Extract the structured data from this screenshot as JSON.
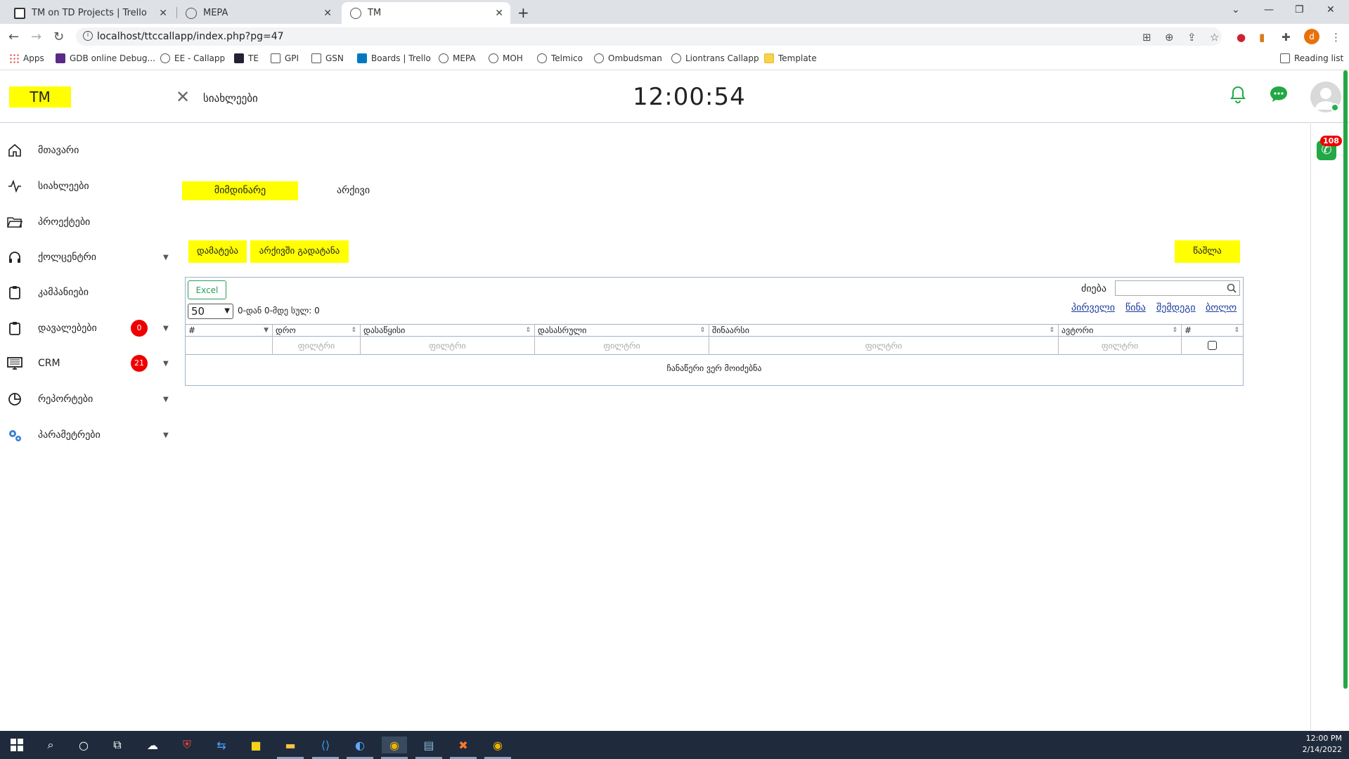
{
  "browser": {
    "tabs": [
      {
        "title": "TM on TD Projects | Trello"
      },
      {
        "title": "MEPA"
      },
      {
        "title": "TM"
      }
    ],
    "url": "localhost/ttccallapp/index.php?pg=47",
    "profile_initial": "d",
    "bookmarks": [
      "Apps",
      "GDB online Debug...",
      "EE - Callapp",
      "TE",
      "GPI",
      "GSN",
      "Boards | Trello",
      "MEPA",
      "MOH",
      "Telmico",
      "Ombudsman",
      "Liontrans Callapp",
      "Template"
    ],
    "reading_list": "Reading list"
  },
  "header": {
    "logo": "TM",
    "page_title": "სიახლეები",
    "clock": "12:00:54",
    "phone_badge": "108"
  },
  "sidebar": {
    "items": [
      {
        "label": "მთავარი"
      },
      {
        "label": "სიახლეები"
      },
      {
        "label": "პროექტები"
      },
      {
        "label": "ქოლცენტრი"
      },
      {
        "label": "კამპანიები"
      },
      {
        "label": "დავალებები",
        "badge": "0"
      },
      {
        "label": "CRM",
        "badge": "21"
      },
      {
        "label": "რეპორტები"
      },
      {
        "label": "პარამეტრები"
      }
    ]
  },
  "tabs": {
    "current": "მიმდინარე",
    "archive": "არქივი"
  },
  "toolbar": {
    "add": "დამატება",
    "to_archive": "არქივში გადატანა",
    "delete": "წაშლა"
  },
  "table": {
    "excel": "Excel",
    "page_size": "50",
    "info": "0-დან 0-მდე სულ: 0",
    "search_label": "ძიება",
    "pager": {
      "first": "პირველი",
      "prev": "წინა",
      "next": "შემდეგი",
      "last": "ბოლო"
    },
    "columns": [
      "#",
      "დრო",
      "დასაწყისი",
      "დასასრული",
      "შინაარსი",
      "ავტორი",
      "#"
    ],
    "filter_placeholder": "ფილტრი",
    "empty_text": "ჩანაწერი ვერ მოიძებნა"
  },
  "taskbar": {
    "time": "12:00 PM",
    "date": "2/14/2022"
  }
}
